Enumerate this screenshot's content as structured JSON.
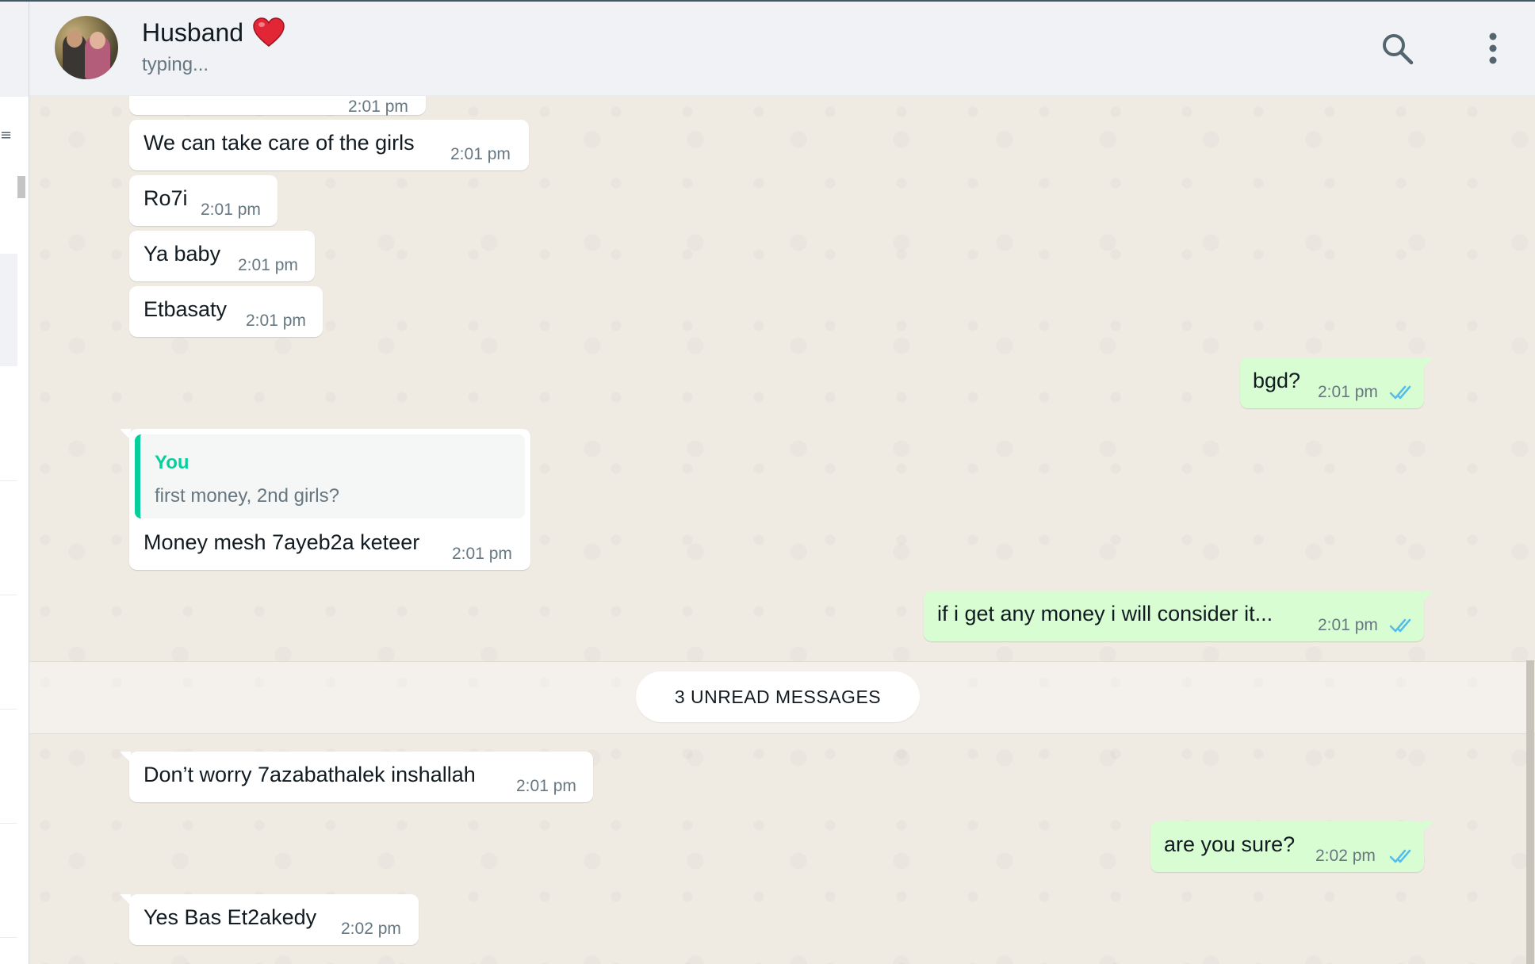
{
  "contact": {
    "name": "Husband",
    "status": "typing..."
  },
  "header_icons": [
    "heart-icon",
    "search-icon",
    "menu-icon"
  ],
  "colors": {
    "incoming_bubble": "#ffffff",
    "outgoing_bubble": "#d9fdd3",
    "read_ticks": "#53bdeb",
    "quote_accent": "#06cf9c",
    "chat_background": "#efeae2"
  },
  "messages": [
    {
      "direction": "in",
      "text": "",
      "time": "2:01 pm"
    },
    {
      "direction": "in",
      "text": "We can take care of the girls",
      "time": "2:01 pm"
    },
    {
      "direction": "in",
      "text": "Ro7i",
      "time": "2:01 pm"
    },
    {
      "direction": "in",
      "text": "Ya baby",
      "time": "2:01 pm"
    },
    {
      "direction": "in",
      "text": "Etbasaty",
      "time": "2:01 pm"
    },
    {
      "direction": "out",
      "text": "bgd?",
      "time": "2:01 pm",
      "status": "read"
    },
    {
      "direction": "in",
      "quote": {
        "author": "You",
        "text": "first money, 2nd girls?"
      },
      "text": "Money mesh 7ayeb2a keteer",
      "time": "2:01 pm"
    },
    {
      "direction": "out",
      "text": "if i get any money i will consider it...",
      "time": "2:01 pm",
      "status": "read"
    },
    {
      "direction": "in",
      "text": "Don’t worry 7azabathalek inshallah",
      "time": "2:01 pm"
    },
    {
      "direction": "out",
      "text": "are you sure?",
      "time": "2:02 pm",
      "status": "read"
    },
    {
      "direction": "in",
      "text": "Yes Bas Et2akedy",
      "time": "2:02 pm"
    }
  ],
  "unread_divider": "3 UNREAD MESSAGES"
}
